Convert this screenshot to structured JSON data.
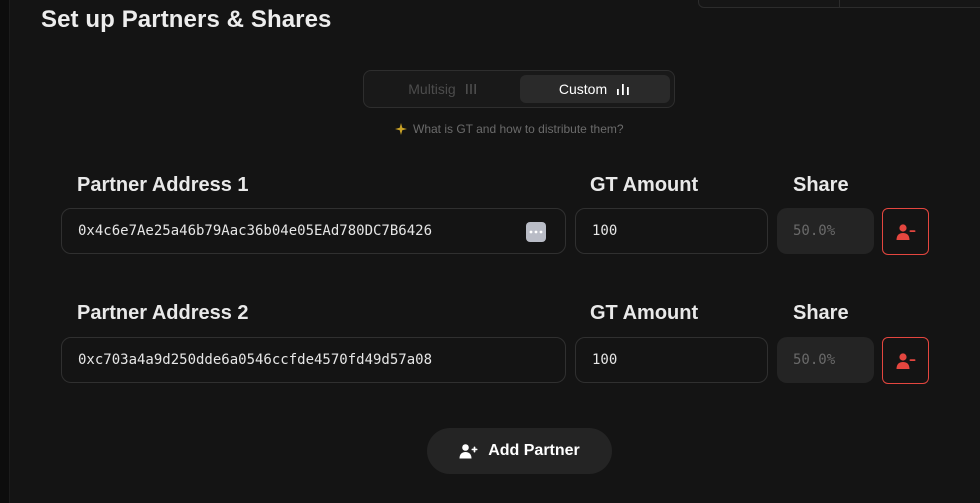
{
  "page": {
    "title": "Set up Partners & Shares"
  },
  "mode_toggle": {
    "options": [
      {
        "label": "Multisig",
        "icon": "vertical-bars-icon",
        "selected": false
      },
      {
        "label": "Custom",
        "icon": "bar-chart-icon",
        "selected": true
      }
    ]
  },
  "hint": {
    "text": "What is GT and how to distribute them?",
    "icon": "sparkle-icon"
  },
  "partners": [
    {
      "address_label": "Partner Address 1",
      "address_value": "0x4c6e7Ae25a46b79Aac36b04e05EAd780DC7B6426",
      "amount_label": "GT Amount",
      "amount_value": "100",
      "share_label": "Share",
      "share_value": "50.0%"
    },
    {
      "address_label": "Partner Address 2",
      "address_value": "0xc703a4a9d250dde6a0546ccfde4570fd49d57a08",
      "amount_label": "GT Amount",
      "amount_value": "100",
      "share_label": "Share",
      "share_value": "50.0%"
    }
  ],
  "add_partner": {
    "label": "Add Partner",
    "icon": "user-plus-icon"
  },
  "colors": {
    "background": "#141414",
    "danger": "#e4463f",
    "hint_star": "#c9a227"
  }
}
